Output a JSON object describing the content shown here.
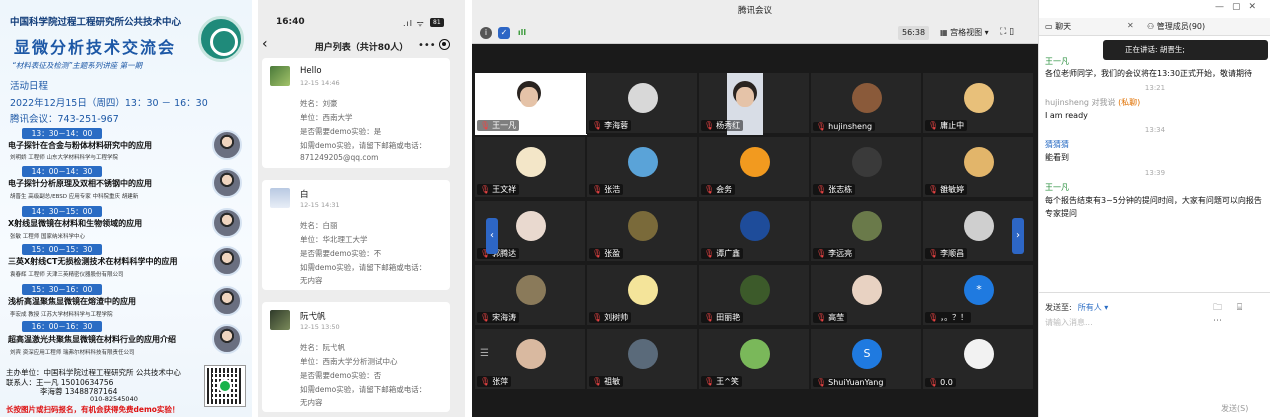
{
  "poster": {
    "org": "中国科学院过程工程研究所公共技术中心",
    "title": "显微分析技术交流会",
    "series": "“材料表征及检测”主题系列讲座 第一期",
    "section_label": "活动日程",
    "date_line": "2022年12月15日（周四）13：30 － 16：30",
    "meeting_line": "腾讯会议：743-251-967",
    "talks": [
      {
        "time": "13：30－14：00",
        "title": "电子探针在合金与粉体材料研究中的应用",
        "speaker": "刘明娇 工程师 山东大学材料科学与工程学院"
      },
      {
        "time": "14：00－14：30",
        "title": "电子探针分析原理及双相不锈钢中的应用",
        "speaker": "胡晋生 高级副总/EBSD 应用专家 中科院重庆 胡建新"
      },
      {
        "time": "14：30－15：00",
        "title": "X射线显微镜在材料和生物领域的应用",
        "speaker": "张敏 工程师 国家纳米科学中心"
      },
      {
        "time": "15：00－15：30",
        "title": "三英X射线CT无损检测技术在材料科学中的应用",
        "speaker": "袁春辉 工程师 天津三英精密仪器股份有限公司"
      },
      {
        "time": "15：30－16：00",
        "title": "浅析高温聚焦显微镜在熔渣中的应用",
        "speaker": "李宏成 教授 江苏大学材料科学与工程学院"
      },
      {
        "time": "16：00－16：30",
        "title": "超高温激光共聚焦显微镜在材料行业的应用介绍",
        "speaker": "刘宾 资深应用工程师 瑞弗尔材料科技有限责任公司"
      }
    ],
    "host": "主办单位：中国科学院过程工程研究所 公共技术中心",
    "contact1": "联系人：王一凡 15010634756",
    "contact2": "李海蓉 13488787164",
    "contact3": "010-82545040",
    "warning": "长按图片或扫码报名，有机会获得免费demo实验！"
  },
  "phone": {
    "time": "16:40",
    "battery": "81",
    "title": "用户列表（共计80人）",
    "cards": [
      {
        "name": "Hello",
        "date": "12-15 14:46",
        "lines": [
          "姓名：刘豪",
          "单位：西南大学",
          "是否需要demo实验：是",
          "如需demo实验，请留下邮箱或电话：",
          "871249205@qq.com"
        ]
      },
      {
        "name": "白",
        "date": "12-15 14:31",
        "lines": [
          "姓名：白丽",
          "单位：华北理工大学",
          "是否需要demo实验：不",
          "如需demo实验，请留下邮箱或电话：",
          "无内容"
        ]
      },
      {
        "name": "阮弋帆",
        "date": "12-15 13:50",
        "lines": [
          "姓名：阮弋帆",
          "单位：西南大学分析测试中心",
          "是否需要demo实验：否",
          "如需demo实验，请留下邮箱或电话：",
          "无内容"
        ]
      }
    ]
  },
  "meeting": {
    "title": "腾讯会议",
    "duration": "56:38",
    "view_label": "宫格视图",
    "colors": {
      "bg": "#1a1a1a",
      "tile": "#262626",
      "accent": "#2d66c5",
      "mute": "#e44444"
    },
    "participants": [
      {
        "name": "王一凡",
        "kind": "video"
      },
      {
        "name": "李海蓉",
        "kind": "avatar",
        "color": "#d8d8d8"
      },
      {
        "name": "杨秀红",
        "kind": "video"
      },
      {
        "name": "hujinsheng",
        "kind": "avatar",
        "color": "#8a5a3a"
      },
      {
        "name": "庸止中",
        "kind": "avatar",
        "color": "#e8c07a"
      },
      {
        "name": "王文祥",
        "kind": "avatar",
        "color": "#f3e6c8"
      },
      {
        "name": "张浩",
        "kind": "avatar",
        "color": "#5aa3d8"
      },
      {
        "name": "会务",
        "kind": "avatar",
        "color": "#f29a1f"
      },
      {
        "name": "张志栋",
        "kind": "avatar",
        "color": "#3a3a3a"
      },
      {
        "name": "雒敏婷",
        "kind": "avatar",
        "color": "#e2b56a"
      },
      {
        "name": "郭腾达",
        "kind": "avatar",
        "color": "#e9d9cf"
      },
      {
        "name": "张盈",
        "kind": "avatar",
        "color": "#7a6a3a"
      },
      {
        "name": "谭广鑫",
        "kind": "avatar",
        "color": "#1e4c9a"
      },
      {
        "name": "李远亮",
        "kind": "avatar",
        "color": "#6a7a4a"
      },
      {
        "name": "李顺昌",
        "kind": "avatar",
        "color": "#cfcfcf"
      },
      {
        "name": "宋海涛",
        "kind": "avatar",
        "color": "#8a7a5a"
      },
      {
        "name": "刘树帅",
        "kind": "avatar",
        "color": "#f4e49a"
      },
      {
        "name": "田丽艳",
        "kind": "avatar",
        "color": "#3c5a2a"
      },
      {
        "name": "高莹",
        "kind": "avatar",
        "color": "#e8d2c2"
      },
      {
        "name": "，。？！",
        "kind": "initial",
        "color": "#1f7ae0",
        "initial": "*"
      },
      {
        "name": "张萍",
        "kind": "avatar",
        "color": "#d9b9a0"
      },
      {
        "name": "祖敏",
        "kind": "avatar",
        "color": "#5a6a7a"
      },
      {
        "name": "王^笑",
        "kind": "avatar",
        "color": "#7ab85a"
      },
      {
        "name": "ShuiYuanYang",
        "kind": "initial",
        "color": "#1f7ae0",
        "initial": "S"
      },
      {
        "name": "0.0",
        "kind": "avatar",
        "color": "#f2f2f2"
      }
    ]
  },
  "chat": {
    "tab_chat": "聊天",
    "tab_members": "管理成员(90)",
    "speaking": "正在讲话: 胡晋生;",
    "messages": [
      {
        "sender": "王一凡",
        "private": "",
        "text": "各位老师同学，我们的会议将在13:30正式开始，敬请期待",
        "time": "13:21"
      },
      {
        "sender": "hujinsheng 对我说",
        "private": "(私聊)",
        "text": "I am ready",
        "time": "13:34"
      },
      {
        "sender": "猜猜猜",
        "private": "",
        "text": "能看到",
        "time": "13:39"
      },
      {
        "sender": "王一凡",
        "private": "",
        "text": "每个报告结束有3~5分钟的提问时间，大家有问题可以向报告专家提问",
        "time": ""
      }
    ],
    "send_to_label": "发送至:",
    "send_to_value": "所有人 ▾",
    "placeholder": "请输入消息...",
    "send_label": "发送(S)"
  }
}
